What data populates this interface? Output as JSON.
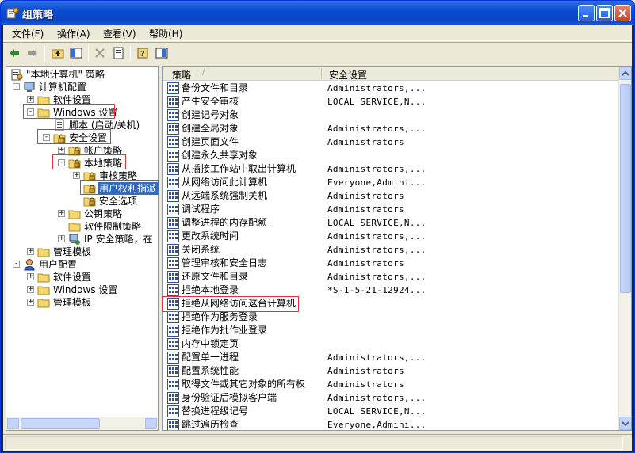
{
  "window": {
    "title": "组策略"
  },
  "menu": [
    "文件(F)",
    "操作(A)",
    "查看(V)",
    "帮助(H)"
  ],
  "tree": [
    {
      "label": "\"本地计算机\" 策略",
      "level": 0,
      "expander": "",
      "icon": "policy-icon"
    },
    {
      "label": "计算机配置",
      "level": 1,
      "expander": "-",
      "icon": "computer-icon"
    },
    {
      "label": "软件设置",
      "level": 2,
      "expander": "+",
      "icon": "folder-icon"
    },
    {
      "label": "Windows 设置",
      "level": 2,
      "expander": "-",
      "icon": "folder-icon"
    },
    {
      "label": "脚本 (启动/关机)",
      "level": 3,
      "expander": "",
      "icon": "script-icon"
    },
    {
      "label": "安全设置",
      "level": 3,
      "expander": "-",
      "icon": "security-icon"
    },
    {
      "label": "帐户策略",
      "level": 4,
      "expander": "+",
      "icon": "folder-lock-icon"
    },
    {
      "label": "本地策略",
      "level": 4,
      "expander": "-",
      "icon": "folder-lock-icon"
    },
    {
      "label": "审核策略",
      "level": 5,
      "expander": "+",
      "icon": "folder-lock-icon"
    },
    {
      "label": "用户权利指派",
      "level": 5,
      "expander": "",
      "icon": "folder-lock-icon",
      "selected": true
    },
    {
      "label": "安全选项",
      "level": 5,
      "expander": "",
      "icon": "folder-lock-icon"
    },
    {
      "label": "公钥策略",
      "level": 4,
      "expander": "+",
      "icon": "folder-icon"
    },
    {
      "label": "软件限制策略",
      "level": 4,
      "expander": "",
      "icon": "folder-icon"
    },
    {
      "label": "IP 安全策略，在",
      "level": 4,
      "expander": "+",
      "icon": "ipsec-icon"
    },
    {
      "label": "管理模板",
      "level": 2,
      "expander": "+",
      "icon": "folder-icon"
    },
    {
      "label": "用户配置",
      "level": 1,
      "expander": "-",
      "icon": "user-icon"
    },
    {
      "label": "软件设置",
      "level": 2,
      "expander": "+",
      "icon": "folder-icon"
    },
    {
      "label": "Windows 设置",
      "level": 2,
      "expander": "+",
      "icon": "folder-icon"
    },
    {
      "label": "管理模板",
      "level": 2,
      "expander": "+",
      "icon": "folder-icon"
    }
  ],
  "list": {
    "columns": [
      "策略",
      "安全设置"
    ],
    "rows": [
      {
        "policy": "备份文件和目录",
        "setting": "Administrators,..."
      },
      {
        "policy": "产生安全审核",
        "setting": "LOCAL SERVICE,N..."
      },
      {
        "policy": "创建记号对象",
        "setting": ""
      },
      {
        "policy": "创建全局对象",
        "setting": "Administrators,..."
      },
      {
        "policy": "创建页面文件",
        "setting": "Administrators"
      },
      {
        "policy": "创建永久共享对象",
        "setting": ""
      },
      {
        "policy": "从插接工作站中取出计算机",
        "setting": "Administrators,..."
      },
      {
        "policy": "从网络访问此计算机",
        "setting": "Everyone,Admini..."
      },
      {
        "policy": "从远端系统强制关机",
        "setting": "Administrators"
      },
      {
        "policy": "调试程序",
        "setting": "Administrators"
      },
      {
        "policy": "调整进程的内存配额",
        "setting": "LOCAL SERVICE,N..."
      },
      {
        "policy": "更改系统时间",
        "setting": "Administrators,..."
      },
      {
        "policy": "关闭系统",
        "setting": "Administrators,..."
      },
      {
        "policy": "管理审核和安全日志",
        "setting": "Administrators"
      },
      {
        "policy": "还原文件和目录",
        "setting": "Administrators,..."
      },
      {
        "policy": "拒绝本地登录",
        "setting": "*S-1-5-21-12924..."
      },
      {
        "policy": "拒绝从网络访问这台计算机",
        "setting": ""
      },
      {
        "policy": "拒绝作为服务登录",
        "setting": ""
      },
      {
        "policy": "拒绝作为批作业登录",
        "setting": ""
      },
      {
        "policy": "内存中锁定页",
        "setting": ""
      },
      {
        "policy": "配置单一进程",
        "setting": "Administrators,..."
      },
      {
        "policy": "配置系统性能",
        "setting": "Administrators"
      },
      {
        "policy": "取得文件或其它对象的所有权",
        "setting": "Administrators"
      },
      {
        "policy": "身份验证后模拟客户端",
        "setting": "Administrators,..."
      },
      {
        "policy": "替换进程级记号",
        "setting": "LOCAL SERVICE,N..."
      },
      {
        "policy": "跳过遍历检查",
        "setting": "Everyone,Admini..."
      }
    ]
  },
  "colors": {
    "titlebar": "#0a4bd0",
    "selection": "#316ac5",
    "highlight_box": "#e8303a"
  }
}
